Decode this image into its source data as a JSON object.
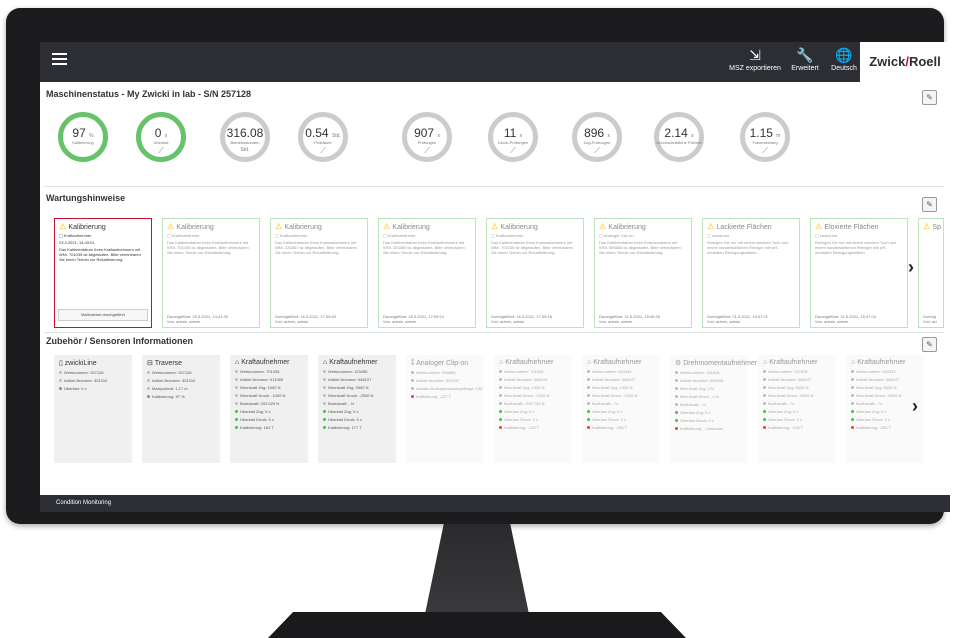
{
  "topbar": {
    "export_label": "MSZ exportieren",
    "advanced_label": "Erweitert",
    "language_label": "Deutsch",
    "logo_left": "Zwick",
    "logo_right": "Roell"
  },
  "machine_status": {
    "title": "Maschinenstatus - My Zwicki in lab - S/N 257128",
    "gauges": [
      {
        "value": "97",
        "unit": "%",
        "label": "Kalibrierung",
        "green": true,
        "chart": false
      },
      {
        "value": "0",
        "unit": "x",
        "label": "Überlast",
        "green": true,
        "chart": true
      },
      {
        "value": "316.08",
        "unit": "Std.",
        "label": "Betriebsstunden",
        "green": false,
        "chart": false
      },
      {
        "value": "0.54",
        "unit": "Std.",
        "label": "Prüfdauer",
        "green": false,
        "chart": true
      },
      {
        "value": "907",
        "unit": "x",
        "label": "Prüfungen",
        "green": false,
        "chart": true
      },
      {
        "value": "11",
        "unit": "x",
        "label": "Druck-Prüfungen",
        "green": false,
        "chart": true
      },
      {
        "value": "896",
        "unit": "x",
        "label": "Zug-Prüfungen",
        "green": false,
        "chart": true
      },
      {
        "value": "2.14",
        "unit": "s",
        "label": "Durchschnittliche Prüfzeit",
        "green": false,
        "chart": false
      },
      {
        "value": "1.15",
        "unit": "m",
        "label": "Traversenweg",
        "green": false,
        "chart": true
      }
    ]
  },
  "maintenance": {
    "title": "Wartungshinweise",
    "cards": [
      {
        "title": "Kalibrierung",
        "sub": "Kraftaufnehmer",
        "date": "23.3.2021, 14:43:01",
        "body": "Das Kalibrierdatum Ihres Kraftaufnehmers mit WNr. 701035 ist abgelaufen. Bitte vereinbaren Sie einen Termin zur Rekalibrierung.",
        "done": "Maßnahme durchgeführt",
        "active": true
      },
      {
        "title": "Kalibrierung",
        "sub": "Kraftaufnehmer",
        "body": "Das Kalibrierdatum Ihres Kraftaufnehmers mit WNr. 701035 ist abgelaufen. Bitte vereinbaren Sie einen Termin zur Rekalibrierung.",
        "date": "Durchgeführt: 25.3.2021, 14:41:39",
        "by": "Von: admin, admin",
        "active": false
      },
      {
        "title": "Kalibrierung",
        "sub": "Kraftaufnehmer",
        "body": "Das Kalibrierdatum Ihres Kraftaufnehmers mit WNr. 333367 ist abgelaufen. Bitte vereinbaren Sie einen Termin zur Rekalibrierung.",
        "date": "Durchgeführt: 16.3.2021, 17:09:53",
        "by": "Von: admin, admin",
        "active": false
      },
      {
        "title": "Kalibrierung",
        "sub": "Kraftaufnehmer",
        "body": "Das Kalibrierdatum Ihres Kraftaufnehmers mit WNr. 333369 ist abgelaufen. Bitte vereinbaren Sie einen Termin zur Rekalibrierung.",
        "date": "Durchgeführt: 16.3.2021, 17:09:24",
        "by": "Von: admin, admin",
        "active": false
      },
      {
        "title": "Kalibrierung",
        "sub": "Kraftaufnehmer",
        "body": "Das Kalibrierdatum Ihres Kraftaufnehmers mit WNr. 701035 ist abgelaufen. Bitte vereinbaren Sie einen Termin zur Rekalibrierung.",
        "date": "Durchgeführt: 16.3.2021, 17:09:16",
        "by": "Von: admin, admin",
        "active": false
      },
      {
        "title": "Kalibrierung",
        "sub": "Analoger Clip-on",
        "body": "Das Kalibrierdatum Ihres Extensometers mit WNr. 555666 ist abgelaufen. Bitte vereinbaren Sie einen Termin zur Rekalibrierung.",
        "date": "Durchgeführt: 21.5.2021, 15:45:33",
        "by": "Von: admin, admin",
        "active": false
      },
      {
        "title": "Lackierte Flächen",
        "sub": "zwickLine",
        "body": "Reinigen Sie nur mit einem weichen Tuch und einem handelsüblichen Reiniger wie pH-neutralen Reinigungsmitteln.",
        "date": "Durchgeführt: 21.5.2021, 15:47:01",
        "by": "Von: admin, admin",
        "active": false
      },
      {
        "title": "Eloxierte Flächen",
        "sub": "zwickLine",
        "body": "Reinigen Sie nur mit einem weichen Tuch und einem handelsüblichen Reiniger wie pH-neutralen Reinigungsmitteln.",
        "date": "Durchgeführt: 21.5.2021, 15:47:04",
        "by": "Von: admin, admin",
        "active": false
      },
      {
        "title": "Sp",
        "sub": "",
        "body": "",
        "date": "Durchg",
        "by": "Von: ad",
        "active": false
      }
    ]
  },
  "sensors": {
    "title": "Zubehör / Sensoren Informationen",
    "cards": [
      {
        "icon": "machine",
        "title": "zwickiLine",
        "faded": false,
        "rows": [
          {
            "dot": "n",
            "text": "Werknummer: 257128"
          },
          {
            "dot": "n",
            "text": "Artikel-Nummer: 391310"
          },
          {
            "dot": "g",
            "text": "Überlast: 0 x"
          }
        ]
      },
      {
        "icon": "traverse",
        "title": "Traverse",
        "faded": false,
        "rows": [
          {
            "dot": "n",
            "text": "Werknummer: 257128"
          },
          {
            "dot": "n",
            "text": "Artikel-Nummer: 391310"
          },
          {
            "dot": "n",
            "text": "Maxiposicht: 1.17 m"
          },
          {
            "dot": "g",
            "text": "Kalibrierung: 97 %"
          }
        ]
      },
      {
        "icon": "loadcell",
        "title": "Kraftaufnehmer",
        "faded": false,
        "rows": [
          {
            "dot": "n",
            "text": "Werknummer: 701035"
          },
          {
            "dot": "n",
            "text": "Artikel-Nummer: 011089"
          },
          {
            "dot": "n",
            "text": "Nennkraft Zug: 1000 N"
          },
          {
            "dot": "n",
            "text": "Nennkraft Druck: -1000 N"
          },
          {
            "dot": "n",
            "text": "Bruttokraft: 293.029 N"
          },
          {
            "dot": "g",
            "text": "Überlast Zug: 0 x"
          },
          {
            "dot": "g",
            "text": "Überlast Druck: 0 x"
          },
          {
            "dot": "g",
            "text": "Kalibrierung: 181 T"
          }
        ]
      },
      {
        "icon": "loadcell",
        "title": "Kraftaufnehmer",
        "faded": false,
        "rows": [
          {
            "dot": "n",
            "text": "Werknummer: 123456"
          },
          {
            "dot": "n",
            "text": "Artikel-Nummer: 066107"
          },
          {
            "dot": "n",
            "text": "Nennkraft Zug: 2500 N"
          },
          {
            "dot": "n",
            "text": "Nennkraft Druck: -2500 N"
          },
          {
            "dot": "n",
            "text": "Bruttokraft: - N"
          },
          {
            "dot": "g",
            "text": "Überlast Zug: 0 x"
          },
          {
            "dot": "g",
            "text": "Überlast Druck: 0 x"
          },
          {
            "dot": "g",
            "text": "Kalibrierung: 177 T"
          }
        ]
      },
      {
        "icon": "clipon",
        "title": "Analoger Clip-on",
        "faded": true,
        "rows": [
          {
            "dot": "n",
            "text": "Werknummer: 555666"
          },
          {
            "dot": "n",
            "text": "Artikel-Nummer: 301037"
          },
          {
            "dot": "n",
            "text": "Ansatz-/Anfangsmessungslänge: 195"
          },
          {
            "dot": "r",
            "text": "Kalibrierung: -227 T"
          }
        ]
      },
      {
        "icon": "loadcell",
        "title": "Kraftaufnehmer",
        "faded": true,
        "rows": [
          {
            "dot": "n",
            "text": "Werknummer: 701035"
          },
          {
            "dot": "n",
            "text": "Artikel-Nummer: 066124"
          },
          {
            "dot": "n",
            "text": "Nennkraft Zug: 1000 N"
          },
          {
            "dot": "n",
            "text": "Nennkraft Druck: -1000 N"
          },
          {
            "dot": "n",
            "text": "Bruttokraft: -230 734 N"
          },
          {
            "dot": "g",
            "text": "Überlast Zug: 0 x"
          },
          {
            "dot": "g",
            "text": "Überlast Druck: 0 x"
          },
          {
            "dot": "r",
            "text": "Kalibrierung: -133 T"
          }
        ]
      },
      {
        "icon": "loadcell",
        "title": "Kraftaufnehmer",
        "faded": true,
        "rows": [
          {
            "dot": "n",
            "text": "Werknummer: 444444"
          },
          {
            "dot": "n",
            "text": "Artikel-Nummer: 066107"
          },
          {
            "dot": "n",
            "text": "Nennkraft Zug: 1000 N"
          },
          {
            "dot": "n",
            "text": "Nennkraft Druck: -1000 N"
          },
          {
            "dot": "n",
            "text": "Bruttokraft: - N"
          },
          {
            "dot": "g",
            "text": "Überlast Zug: 0 x"
          },
          {
            "dot": "g",
            "text": "Überlast Druck: 0 x"
          },
          {
            "dot": "r",
            "text": "Kalibrierung: -258 T"
          }
        ]
      },
      {
        "icon": "torque",
        "title": "Drehmomentaufnehmer",
        "faded": true,
        "rows": [
          {
            "dot": "n",
            "text": "Werknummer: 181818"
          },
          {
            "dot": "n",
            "text": "Artikel-Nummer: 066208"
          },
          {
            "dot": "n",
            "text": "Nennkraft Zug: 2 N"
          },
          {
            "dot": "n",
            "text": "Nennkraft Druck: -2 N"
          },
          {
            "dot": "n",
            "text": "Bruttokraft: - N"
          },
          {
            "dot": "g",
            "text": "Überlast Zug: 0 x"
          },
          {
            "dot": "g",
            "text": "Überlast Druck: 0 x"
          },
          {
            "dot": "r",
            "text": "Kalibrierung: - Unknown"
          }
        ]
      },
      {
        "icon": "loadcell",
        "title": "Kraftaufnehmer",
        "faded": true,
        "rows": [
          {
            "dot": "n",
            "text": "Werknummer: 787878"
          },
          {
            "dot": "n",
            "text": "Artikel-Nummer: 066107"
          },
          {
            "dot": "n",
            "text": "Nennkraft Zug: 5000 N"
          },
          {
            "dot": "n",
            "text": "Nennkraft Druck: -5000 N"
          },
          {
            "dot": "n",
            "text": "Bruttokraft: - N"
          },
          {
            "dot": "g",
            "text": "Überlast Zug: 0 x"
          },
          {
            "dot": "g",
            "text": "Überlast Druck: 0 x"
          },
          {
            "dot": "r",
            "text": "Kalibrierung: -218 T"
          }
        ]
      },
      {
        "icon": "loadcell",
        "title": "Kraftaufnehmer",
        "faded": true,
        "rows": [
          {
            "dot": "n",
            "text": "Werknummer: 333333"
          },
          {
            "dot": "n",
            "text": "Artikel-Nummer: 066107"
          },
          {
            "dot": "n",
            "text": "Nennkraft Zug: 5000 N"
          },
          {
            "dot": "n",
            "text": "Nennkraft Druck: -5000 N"
          },
          {
            "dot": "n",
            "text": "Bruttokraft: - N"
          },
          {
            "dot": "g",
            "text": "Überlast Zug: 0 x"
          },
          {
            "dot": "g",
            "text": "Überlast Druck: 0 x"
          },
          {
            "dot": "r",
            "text": "Kalibrierung: -230 T"
          }
        ]
      }
    ]
  },
  "footer": {
    "label": "Condition Monitoring"
  }
}
